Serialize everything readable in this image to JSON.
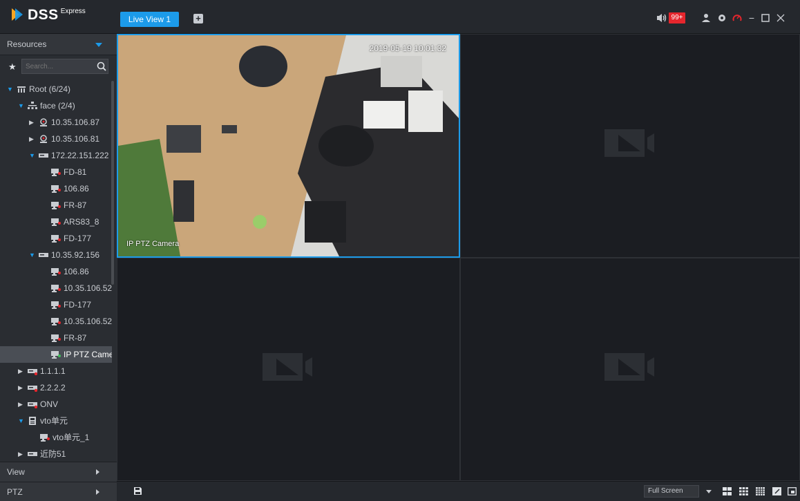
{
  "app": {
    "brand": "DSS",
    "brand_sub": "Express"
  },
  "header": {
    "tab_label": "Live View 1",
    "alarm_count": "99+",
    "icons": [
      "sound-icon",
      "user-icon",
      "settings-icon",
      "speed-icon",
      "minimize-icon",
      "maximize-icon",
      "close-icon"
    ]
  },
  "sidebar": {
    "resources_label": "Resources",
    "search_placeholder": "Search...",
    "tree": [
      {
        "label": "Root (6/24)",
        "icon": "org-root-icon",
        "state": "expanded"
      },
      {
        "label": "face (2/4)",
        "icon": "org-node-icon",
        "state": "expanded"
      },
      {
        "label": "10.35.106.87",
        "icon": "face-device-icon",
        "state": "collapsed"
      },
      {
        "label": "10.35.106.81",
        "icon": "face-device-icon",
        "state": "collapsed"
      },
      {
        "label": "172.22.151.222",
        "icon": "nvr-icon",
        "state": "expanded"
      },
      {
        "label": "FD-81",
        "icon": "camera-channel-icon"
      },
      {
        "label": "106.86",
        "icon": "camera-channel-icon"
      },
      {
        "label": "FR-87",
        "icon": "camera-channel-icon"
      },
      {
        "label": "ARS83_8",
        "icon": "camera-channel-icon"
      },
      {
        "label": "FD-177",
        "icon": "camera-channel-icon"
      },
      {
        "label": "10.35.92.156",
        "icon": "nvr-icon",
        "state": "expanded"
      },
      {
        "label": "106.86",
        "icon": "camera-channel-icon"
      },
      {
        "label": "10.35.106.52",
        "icon": "camera-channel-icon"
      },
      {
        "label": "FD-177",
        "icon": "camera-channel-icon"
      },
      {
        "label": "10.35.106.52-",
        "icon": "camera-channel-icon"
      },
      {
        "label": "FR-87",
        "icon": "camera-channel-icon"
      },
      {
        "label": "IP PTZ Came",
        "icon": "camera-channel-online-icon",
        "selected": true
      },
      {
        "label": "1.1.1.1",
        "icon": "nvr-offline-icon",
        "state": "collapsed"
      },
      {
        "label": "2.2.2.2",
        "icon": "nvr-offline-icon",
        "state": "collapsed"
      },
      {
        "label": "ONV",
        "icon": "nvr-offline-icon",
        "state": "collapsed"
      },
      {
        "label": "vto单元",
        "icon": "vto-icon",
        "state": "expanded"
      },
      {
        "label": "vto单元_1",
        "icon": "camera-channel-icon"
      },
      {
        "label": "近防51",
        "icon": "nvr-icon",
        "state": "collapsed"
      }
    ],
    "view_label": "View",
    "ptz_label": "PTZ"
  },
  "video": {
    "window1": {
      "timestamp": "2019-05-19 10:01:32",
      "channel_name": "IP PTZ Camera"
    }
  },
  "bottombar": {
    "fullscreen_label": "Full Screen",
    "layout_icons": [
      "layout-4-icon",
      "layout-9-icon",
      "layout-16-icon",
      "custom-layout-icon",
      "window-restore-icon"
    ]
  },
  "colors": {
    "accent": "#1c9bea",
    "alarm": "#e6262d",
    "background": "#1b1d21",
    "panel": "#2a2d32"
  }
}
